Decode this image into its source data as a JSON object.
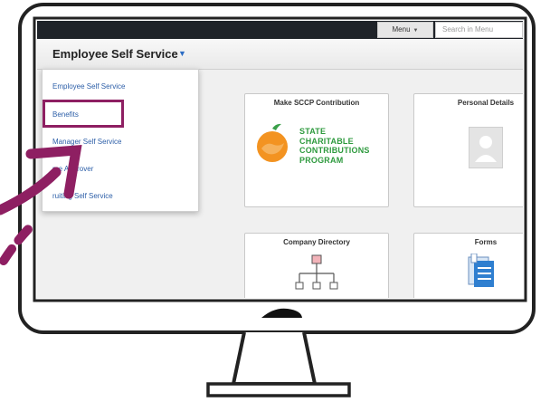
{
  "colors": {
    "accent": "#8e1f62",
    "topbar": "#1f2329",
    "link": "#2d5fa8",
    "sccp_green": "#2e9a3e",
    "sccp_orange": "#f39321"
  },
  "topbar": {
    "menu_label": "Menu",
    "search_placeholder": "Search in Menu"
  },
  "header": {
    "title": "Employee Self Service",
    "caret_icon": "caret-down-icon"
  },
  "dropdown": {
    "items": [
      {
        "label": "Employee Self Service"
      },
      {
        "label": "Benefits",
        "highlighted": true
      },
      {
        "label": "Manager Self Service"
      },
      {
        "label": "me Approver"
      },
      {
        "label": "ruiting Self Service"
      }
    ]
  },
  "tiles": {
    "sccp": {
      "title": "Make SCCP Contribution",
      "logo_lines": [
        "STATE",
        "CHARITABLE",
        "CONTRIBUTIONS",
        "PROGRAM"
      ]
    },
    "personal": {
      "title": "Personal Details",
      "icon": "avatar-placeholder-icon"
    },
    "directory": {
      "title": "Company Directory",
      "icon": "org-chart-icon"
    },
    "forms": {
      "title": "Forms",
      "icon": "forms-icon"
    }
  }
}
